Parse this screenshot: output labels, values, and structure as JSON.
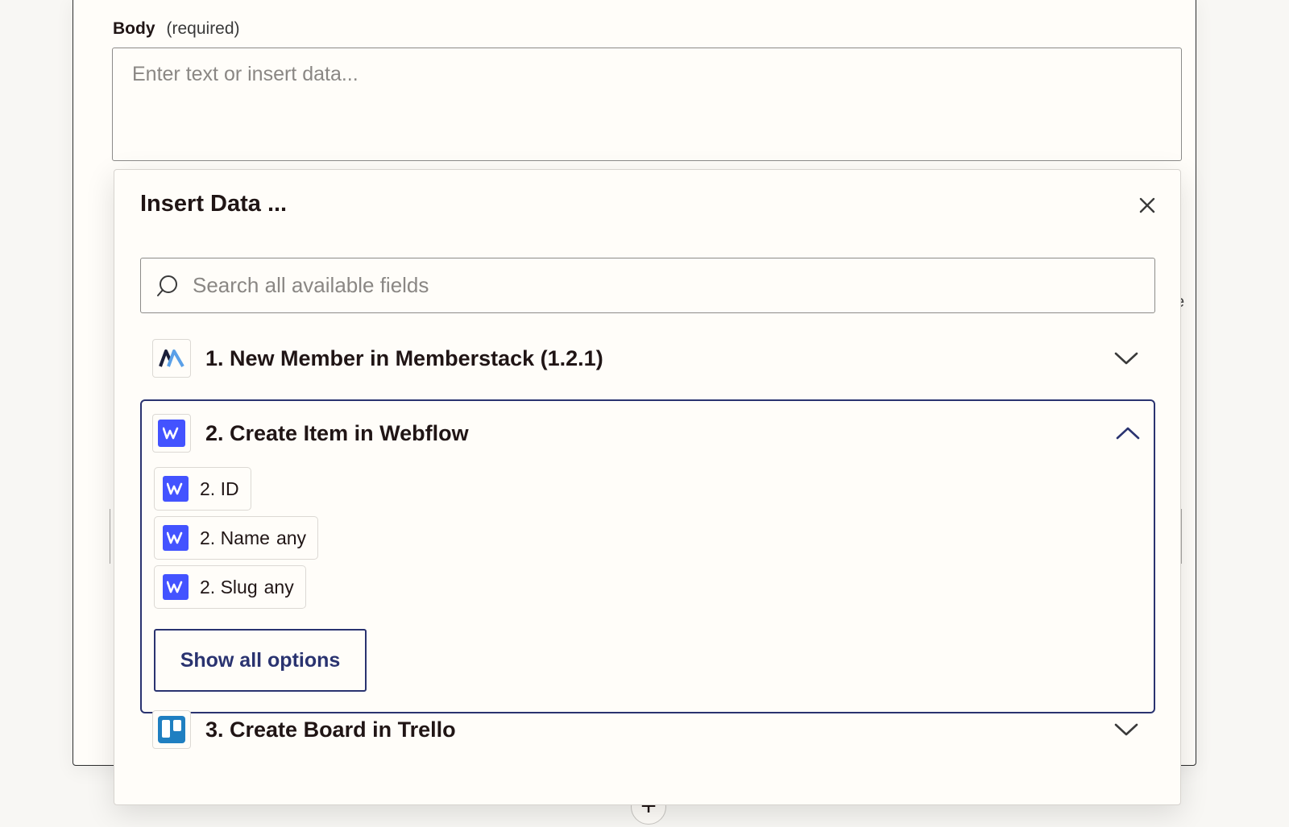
{
  "form": {
    "body_label": "Body",
    "body_required": "(required)",
    "body_placeholder": "Enter text or insert data..."
  },
  "insert_data": {
    "title": "Insert Data ...",
    "search_placeholder": "Search all available fields",
    "sections": [
      {
        "title": "1. New Member in Memberstack (1.2.1)",
        "app": "memberstack",
        "expanded": false
      },
      {
        "title": "2. Create Item in Webflow",
        "app": "webflow",
        "expanded": true,
        "fields": [
          {
            "key": "2. ID",
            "type": ""
          },
          {
            "key": "2. Name",
            "type": "any"
          },
          {
            "key": "2. Slug",
            "type": "any"
          }
        ],
        "show_all_label": "Show all options"
      },
      {
        "title": "3. Create Board in Trello",
        "app": "trello",
        "expanded": false
      }
    ]
  },
  "colors": {
    "accent": "#2a3370",
    "webflow": "#4353ff",
    "trello": "#1f7fc1",
    "background": "#f8f7f4"
  },
  "icons": {
    "close": "close-icon",
    "search": "search-icon",
    "collapsed": "chevron-down-icon",
    "expanded": "chevron-up-icon",
    "add_step": "plus-icon"
  }
}
